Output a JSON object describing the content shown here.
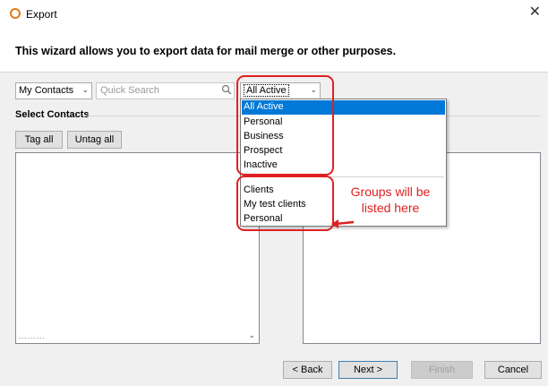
{
  "window": {
    "title": "Export",
    "close_glyph": "✕"
  },
  "banner": {
    "text": "This wizard allows you to export data for mail merge or other purposes."
  },
  "toolbar": {
    "source_combo": "My Contacts",
    "search_placeholder": "Quick Search",
    "filter_combo": "All Active"
  },
  "select_contacts": {
    "label": "Select Contacts",
    "tag_all": "Tag all",
    "untag_all": "Untag all"
  },
  "dropdown": {
    "status_options": [
      "All Active",
      "Personal",
      "Business",
      "Prospect",
      "Inactive"
    ],
    "selected": "All Active",
    "group_options": [
      "Clients",
      "My test clients",
      "Personal"
    ]
  },
  "annotation": {
    "text": "Groups will be listed here",
    "color": "#e02020"
  },
  "footer": {
    "back": "< Back",
    "next": "Next >",
    "finish": "Finish",
    "cancel": "Cancel"
  },
  "colors": {
    "selection": "#0078d7",
    "accent": "#e8791c"
  },
  "icons": {
    "app": "export-app-icon",
    "search": "magnifier-icon",
    "close": "close-icon"
  }
}
